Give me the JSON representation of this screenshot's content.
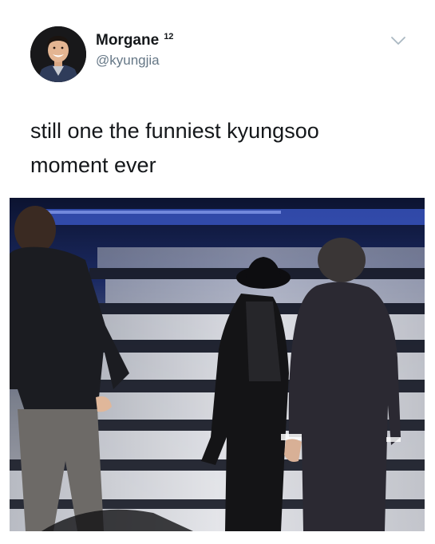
{
  "tweet": {
    "author": {
      "display_name": "Morgane",
      "badge_count": "12",
      "handle": "@kyungjia",
      "avatar_icon": "profile-photo"
    },
    "menu_icon": "chevron-down-icon",
    "text": "still one the funniest kyungsoo\nmoment ever",
    "media": {
      "type": "video-still",
      "description_icon": "stage-photo"
    }
  },
  "colors": {
    "text": "#14171a",
    "secondary_text": "#657786",
    "chevron": "#aab8c2"
  }
}
